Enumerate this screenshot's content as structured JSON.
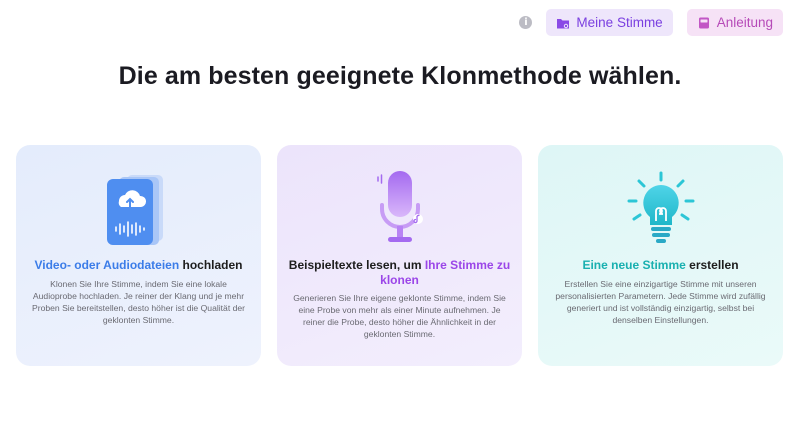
{
  "header": {
    "my_voice_label": "Meine Stimme",
    "guide_label": "Anleitung",
    "info_glyph": "i"
  },
  "title": "Die am besten geeignete Klonmethode wählen.",
  "cards": [
    {
      "icon": "audio-file-upload-icon",
      "heading_highlight": "Video- oder Audiodateien",
      "heading_rest": " hochladen",
      "description": "Klonen Sie Ihre Stimme, indem Sie eine lokale Audioprobe hochladen. Je reiner der Klang und je mehr Proben Sie bereitstellen, desto höher ist die Qualität der geklonten Stimme."
    },
    {
      "icon": "microphone-icon",
      "heading_prefix": "Beispieltexte lesen, um ",
      "heading_highlight": "Ihre Stimme zu klonen",
      "description": "Generieren Sie Ihre eigene geklonte Stimme, indem Sie eine Probe von mehr als einer Minute aufnehmen. Je reiner die Probe, desto höher die Ähnlichkeit in der geklonten Stimme."
    },
    {
      "icon": "lightbulb-icon",
      "heading_highlight": "Eine neue Stimme",
      "heading_rest": " erstellen",
      "description": "Erstellen Sie eine einzigartige Stimme mit unseren personalisierten Parametern. Jede Stimme wird zufällig generiert und ist vollständig einzigartig, selbst bei denselben Einstellungen."
    }
  ],
  "colors": {
    "accent_purple": "#7a3fe0",
    "guide_pink": "#b64ab8",
    "highlight_blue": "#3b7ce8",
    "highlight_purple": "#9b46e8",
    "highlight_teal": "#19b0b0"
  }
}
